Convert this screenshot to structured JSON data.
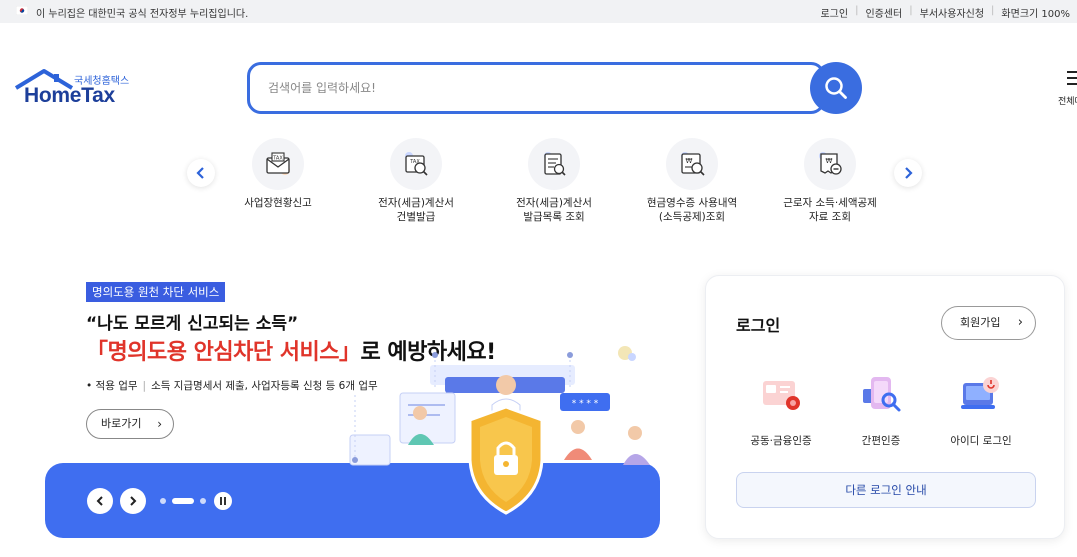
{
  "topbar": {
    "notice": "이 누리집은 대한민국 공식 전자정부 누리집입니다.",
    "links": [
      "로그인",
      "인증센터",
      "부서사용자신청",
      "화면크기 100%"
    ]
  },
  "header": {
    "logo_sub": "국세청홈택스",
    "logo_main": "HomeTax",
    "search_placeholder": "검색어를 입력하세요!",
    "menu_label": "전체메뉴"
  },
  "quick_menu": {
    "items": [
      {
        "label": "사업장현황신고",
        "icon": "tax-envelope-icon"
      },
      {
        "label": "전자(세금)계산서\n건별발급",
        "icon": "tax-search-icon"
      },
      {
        "label": "전자(세금)계산서\n발급목록 조회",
        "icon": "document-search-icon"
      },
      {
        "label": "현금영수증 사용내역\n(소득공제)조회",
        "icon": "receipt-search-icon"
      },
      {
        "label": "근로자 소득·세액공제\n자료 조회",
        "icon": "receipt-minus-icon"
      }
    ]
  },
  "banner": {
    "tag": "명의도용 원천 차단 서비스",
    "headline1": "“나도 모르게 신고되는 소득”",
    "headline2_red": "「명의도용 안심차단 서비스」",
    "headline2_rest": "로 예방하세요!",
    "desc_label": "적용 업무",
    "desc_text": "소득 지급명세서 제출, 사업자등록 신청 등 6개 업무",
    "go_button": "바로가기",
    "slide_current": 2,
    "slide_total": 3
  },
  "login": {
    "title": "로그인",
    "join_button": "회원가입",
    "methods": [
      {
        "label": "공동·금융인증",
        "icon": "certificate-icon"
      },
      {
        "label": "간편인증",
        "icon": "simple-auth-icon"
      },
      {
        "label": "아이디 로그인",
        "icon": "id-login-icon"
      }
    ],
    "other_login": "다른 로그인 안내"
  },
  "colors": {
    "primary": "#3a6de0",
    "banner_blue": "#3f6ef0",
    "accent_red": "#e0342a",
    "navy": "#1d3f9a"
  }
}
